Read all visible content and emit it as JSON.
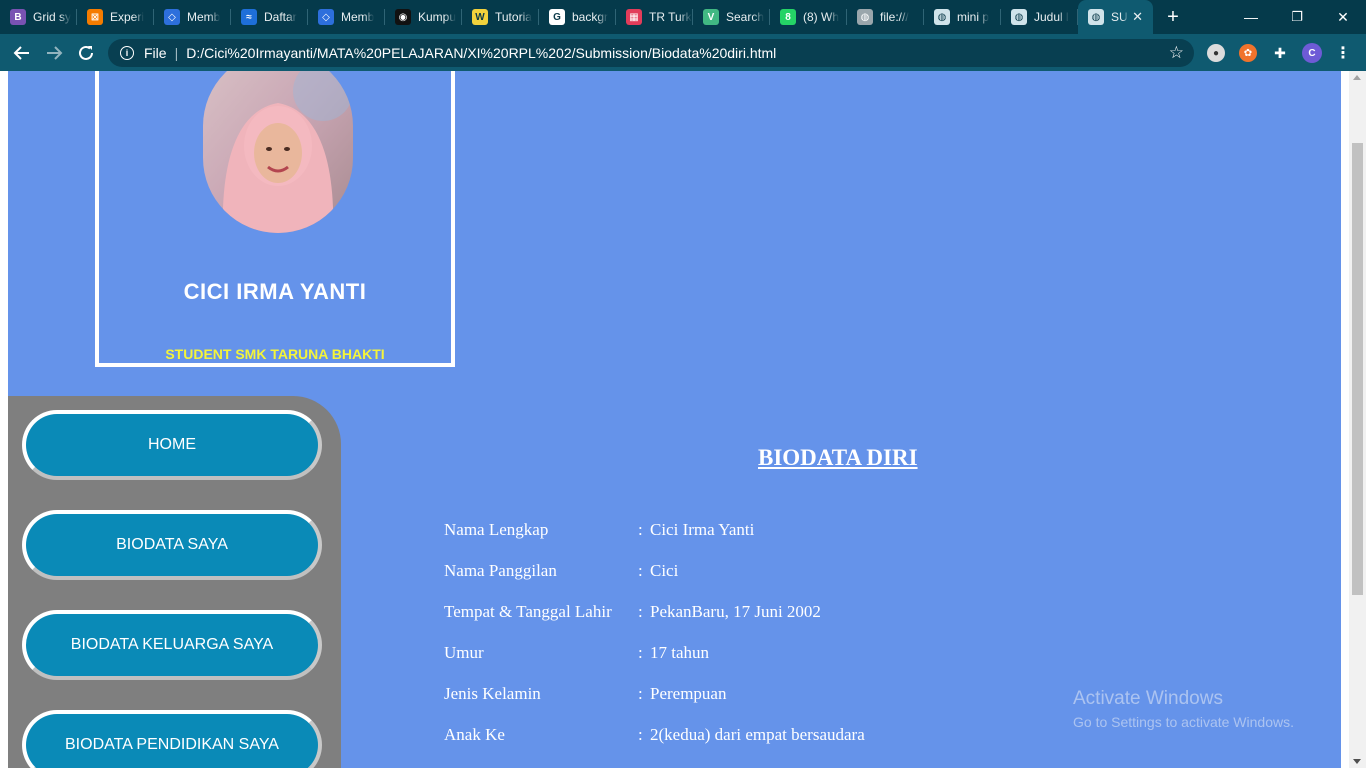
{
  "browser": {
    "tabs": [
      {
        "label": "Grid sy",
        "icon": "bootstrap-icon",
        "color": "#7952b3",
        "glyph": "B"
      },
      {
        "label": "Experi",
        "icon": "xampp-icon",
        "color": "#f57c00",
        "glyph": "⊠"
      },
      {
        "label": "Memb",
        "icon": "dicoding-icon",
        "color": "#2d6fdc",
        "glyph": "◇"
      },
      {
        "label": "Daftar",
        "icon": "wave-icon",
        "color": "#1e6fd9",
        "glyph": "≈"
      },
      {
        "label": "Memb",
        "icon": "dicoding-icon",
        "color": "#2d6fdc",
        "glyph": "◇"
      },
      {
        "label": "Kumpu",
        "icon": "site-icon",
        "color": "#111111",
        "glyph": "◉"
      },
      {
        "label": "Tutoria",
        "icon": "w3schools-icon",
        "color": "#f2d23c",
        "glyph": "W"
      },
      {
        "label": "backgr",
        "icon": "google-icon",
        "color": "#ffffff",
        "glyph": "G"
      },
      {
        "label": "TR Turk",
        "icon": "mosaic-icon",
        "color": "#e23c5a",
        "glyph": "▦"
      },
      {
        "label": "Search",
        "icon": "vue-icon",
        "color": "#41b883",
        "glyph": "V"
      },
      {
        "label": "(8) Wh",
        "icon": "whatsapp-icon",
        "color": "#25d366",
        "glyph": "8"
      },
      {
        "label": "file:///",
        "icon": "globe-icon",
        "color": "#9aa6ac",
        "glyph": "◍"
      },
      {
        "label": "mini p",
        "icon": "globe-icon",
        "color": "#cfe3ea",
        "glyph": "◍"
      },
      {
        "label": "Judul l",
        "icon": "globe-icon",
        "color": "#cfe3ea",
        "glyph": "◍"
      },
      {
        "label": "SU",
        "icon": "globe-icon",
        "color": "#cfe3ea",
        "glyph": "◍"
      }
    ],
    "new_tab": "+",
    "window_controls": {
      "minimize": "—",
      "restore": "❐",
      "close": "✕"
    },
    "address": {
      "scheme": "File",
      "url": "D:/Cici%20Irmayanti/MATA%20PELAJARAN/XI%20RPL%202/Submission/Biodata%20diri.html"
    },
    "profile_initial": "C"
  },
  "profile": {
    "name": "CICI IRMA YANTI",
    "role": "STUDENT SMK TARUNA BHAKTI"
  },
  "menu": [
    {
      "label": "HOME"
    },
    {
      "label": "BIODATA SAYA"
    },
    {
      "label": "BIODATA KELUARGA SAYA"
    },
    {
      "label": "BIODATA PENDIDIKAN SAYA"
    }
  ],
  "biodata": {
    "title": "BIODATA DIRI",
    "rows": [
      {
        "key": "Nama Lengkap",
        "value": "Cici Irma Yanti"
      },
      {
        "key": "Nama Panggilan",
        "value": "Cici"
      },
      {
        "key": "Tempat & Tanggal Lahir",
        "value": "PekanBaru, 17 Juni 2002"
      },
      {
        "key": "Umur",
        "value": "17 tahun"
      },
      {
        "key": "Jenis Kelamin",
        "value": "Perempuan"
      },
      {
        "key": "Anak Ke",
        "value": "2(kedua) dari empat bersaudara"
      }
    ],
    "separator": ":"
  },
  "watermark": {
    "line1": "Activate Windows",
    "line2": "Go to Settings to activate Windows."
  },
  "colors": {
    "page_bg": "#6593ea",
    "sidebar_bg": "#7f7f7f",
    "menu_button": "#0a8ab7",
    "role_text": "#f4f43a",
    "chrome_tabstrip": "#053a4b",
    "chrome_toolbar": "#0f5a70"
  }
}
